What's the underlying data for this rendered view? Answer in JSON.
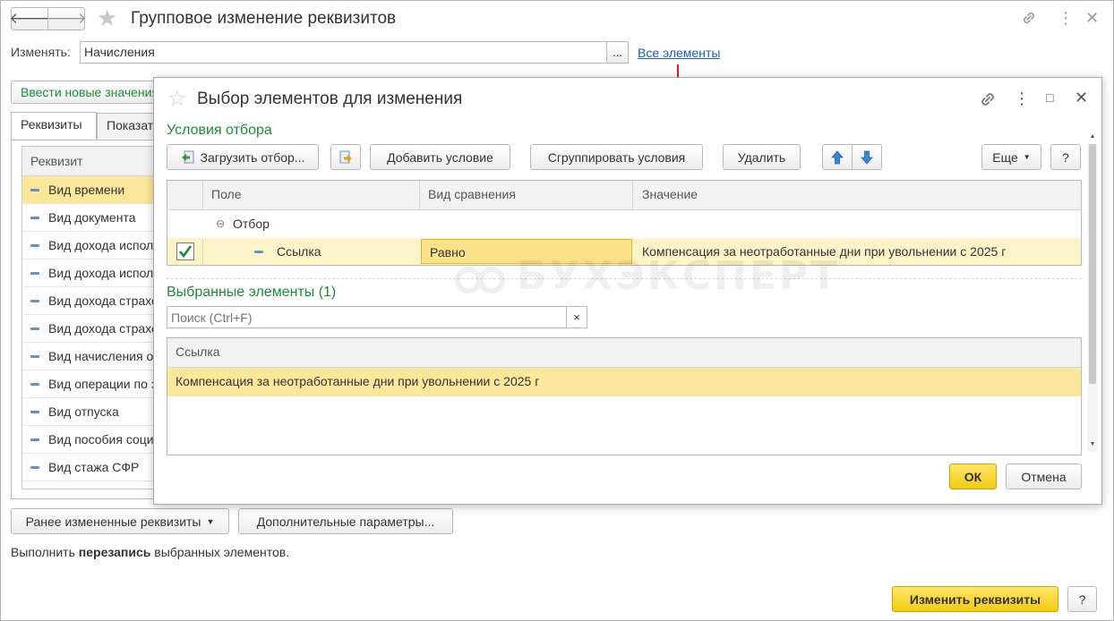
{
  "window": {
    "title": "Групповое изменение реквизитов"
  },
  "main_form": {
    "change_label": "Изменять:",
    "change_value": "Начисления",
    "change_select_button": "...",
    "all_elements_link": "Все элементы",
    "enter_new_values_button": "Ввести новые значения",
    "tabs": [
      {
        "label": "Реквизиты"
      },
      {
        "label": "Показатели"
      }
    ],
    "attributes_header": "Реквизит",
    "attributes": [
      "Вид времени",
      "Вид документа",
      "Вид дохода исполнительного производства",
      "Вид дохода исполнительного листа",
      "Вид дохода страховые взносы",
      "Вид дохода страховые взносы НС",
      "Вид начисления оплаты",
      "Вид операции по зарплате",
      "Вид отпуска",
      "Вид пособия социального страхования",
      "Вид стажа  СФР"
    ],
    "previous_attributes_button": "Ранее измененные реквизиты",
    "additional_params_button": "Дополнительные параметры...",
    "bottom_text_prefix": "Выполнить ",
    "bottom_text_bold": "перезапись",
    "bottom_text_suffix": " выбранных элементов.",
    "apply_button": "Изменить реквизиты",
    "help_button": "?"
  },
  "dialog": {
    "title": "Выбор элементов для изменения",
    "filter_section_title": "Условия отбора",
    "toolbar": {
      "load_filter": "Загрузить отбор...",
      "add_condition": "Добавить условие",
      "group_conditions": "Сгруппировать условия",
      "delete": "Удалить",
      "more": "Еще",
      "help": "?"
    },
    "filter_grid": {
      "columns": [
        "Поле",
        "Вид сравнения",
        "Значение"
      ],
      "group_row": "Отбор",
      "condition": {
        "field": "Ссылка",
        "comparison": "Равно",
        "value": "Компенсация за неотработанные дни при увольнении с 2025 г",
        "checked": true
      }
    },
    "selected_section_title": "Выбранные элементы (1)",
    "search_placeholder": "Поиск (Ctrl+F)",
    "search_clear": "×",
    "selected_grid": {
      "column": "Ссылка",
      "rows": [
        "Компенсация за неотработанные дни при увольнении с 2025 г"
      ]
    },
    "ok_button": "ОК",
    "cancel_button": "Отмена"
  },
  "watermark": "БУХЭКСПЕРТ",
  "colors": {
    "accent_green": "#1e8a3a",
    "selection_yellow": "#fbe799",
    "primary_button": "#f2cc12",
    "link_blue": "#1d5ea8"
  }
}
